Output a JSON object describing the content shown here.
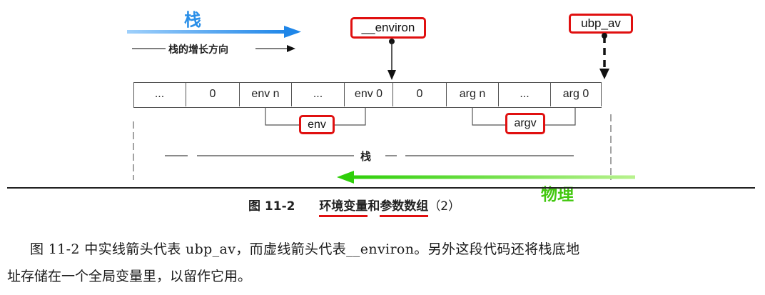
{
  "annotations": {
    "stack_handwritten": "栈",
    "physical_handwritten": "物理"
  },
  "growth_label": "栈的增长方向",
  "stack_bracket_label": "栈",
  "cells": [
    "...",
    "0",
    "env n",
    "...",
    "env 0",
    "0",
    "arg n",
    "...",
    "arg 0"
  ],
  "boxes": {
    "environ": "__environ",
    "ubp_av": "ubp_av",
    "env": "env",
    "argv": "argv"
  },
  "caption": {
    "figure_no": "图 11-2",
    "part1": "环境变量",
    "and": "和",
    "part2": "参数数组",
    "suffix": "（2）"
  },
  "paragraph": {
    "line1": "图 11-2 中实线箭头代表 ubp_av，而虚线箭头代表__environ。另外这段代码还将栈底地",
    "line2": "址存储在一个全局变量里，以留作它用。"
  },
  "colors": {
    "blue_arrow": "#2a8fe8",
    "green_arrow": "#4fd414",
    "red_highlight": "#e01010"
  }
}
